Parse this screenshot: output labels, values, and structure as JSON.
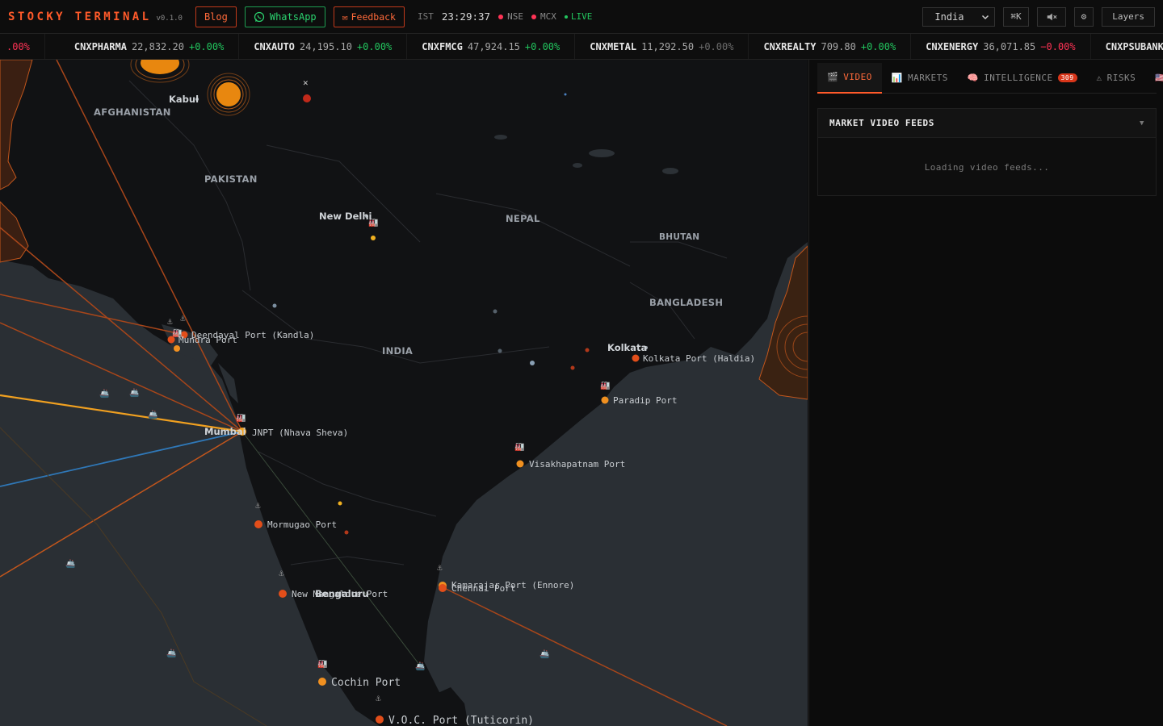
{
  "header": {
    "brand": "STOCKY TERMINAL",
    "version": "v0.1.0",
    "blog_label": "Blog",
    "whatsapp_label": "WhatsApp",
    "feedback_label": "Feedback",
    "timezone": "IST",
    "clock": "23:29:37",
    "markets": [
      "NSE",
      "MCX"
    ],
    "live_label": "LIVE",
    "region_selected": "India",
    "cmdk_label": "⌘K",
    "settings_glyph": "⚙",
    "layers_label": "Layers"
  },
  "ticker": [
    {
      "name": "",
      "value": "",
      "change": ".00%",
      "dir": "down"
    },
    {
      "name": "CNXPHARMA",
      "value": "22,832.20",
      "change": "+0.00%",
      "dir": "up"
    },
    {
      "name": "CNXAUTO",
      "value": "24,195.10",
      "change": "+0.00%",
      "dir": "up"
    },
    {
      "name": "CNXFMCG",
      "value": "47,924.15",
      "change": "+0.00%",
      "dir": "up"
    },
    {
      "name": "CNXMETAL",
      "value": "11,292.50",
      "change": "+0.00%",
      "dir": "flat"
    },
    {
      "name": "CNXREALTY",
      "value": "709.80",
      "change": "+0.00%",
      "dir": "up"
    },
    {
      "name": "CNXENERGY",
      "value": "36,071.85",
      "change": "−0.00%",
      "dir": "down"
    },
    {
      "name": "CNXPSUBANK",
      "value": "",
      "change": "",
      "dir": "flat"
    }
  ],
  "map": {
    "countries": [
      "AFGHANISTAN",
      "PAKISTAN",
      "NEPAL",
      "BHUTAN",
      "BANGLADESH",
      "INDIA"
    ],
    "cities": [
      "Kabul",
      "New Delhi",
      "Kolkata",
      "Mumbai",
      "Bengaluru"
    ],
    "ports": [
      "Deendayal Port (Kandla)",
      "Mundra Port",
      "JNPT (Nhava Sheva)",
      "Kolkata Port (Haldia)",
      "Paradip Port",
      "Visakhapatnam Port",
      "Mormugao Port",
      "New Mangalore Port",
      "Kamarajar Port (Ennore)",
      "Chennai Port",
      "Cochin Port",
      "V.O.C. Port (Tuticorin)"
    ]
  },
  "panel": {
    "tabs": [
      {
        "icon": "🎬",
        "label": "VIDEO",
        "active": true
      },
      {
        "icon": "📊",
        "label": "MARKETS",
        "active": false
      },
      {
        "icon": "🧠",
        "label": "INTELLIGENCE",
        "badge": "309",
        "active": false
      },
      {
        "icon": "⚠",
        "label": "RISKS",
        "active": false
      },
      {
        "icon": "🇺🇸",
        "label": "",
        "active": false
      }
    ],
    "video_card_title": "MARKET VIDEO FEEDS",
    "video_loading": "Loading video feeds..."
  },
  "colors": {
    "accent": "#ff5a2a",
    "up": "#22c55e",
    "down": "#ff3355",
    "land": "#111214",
    "sea": "#2a2f34"
  }
}
